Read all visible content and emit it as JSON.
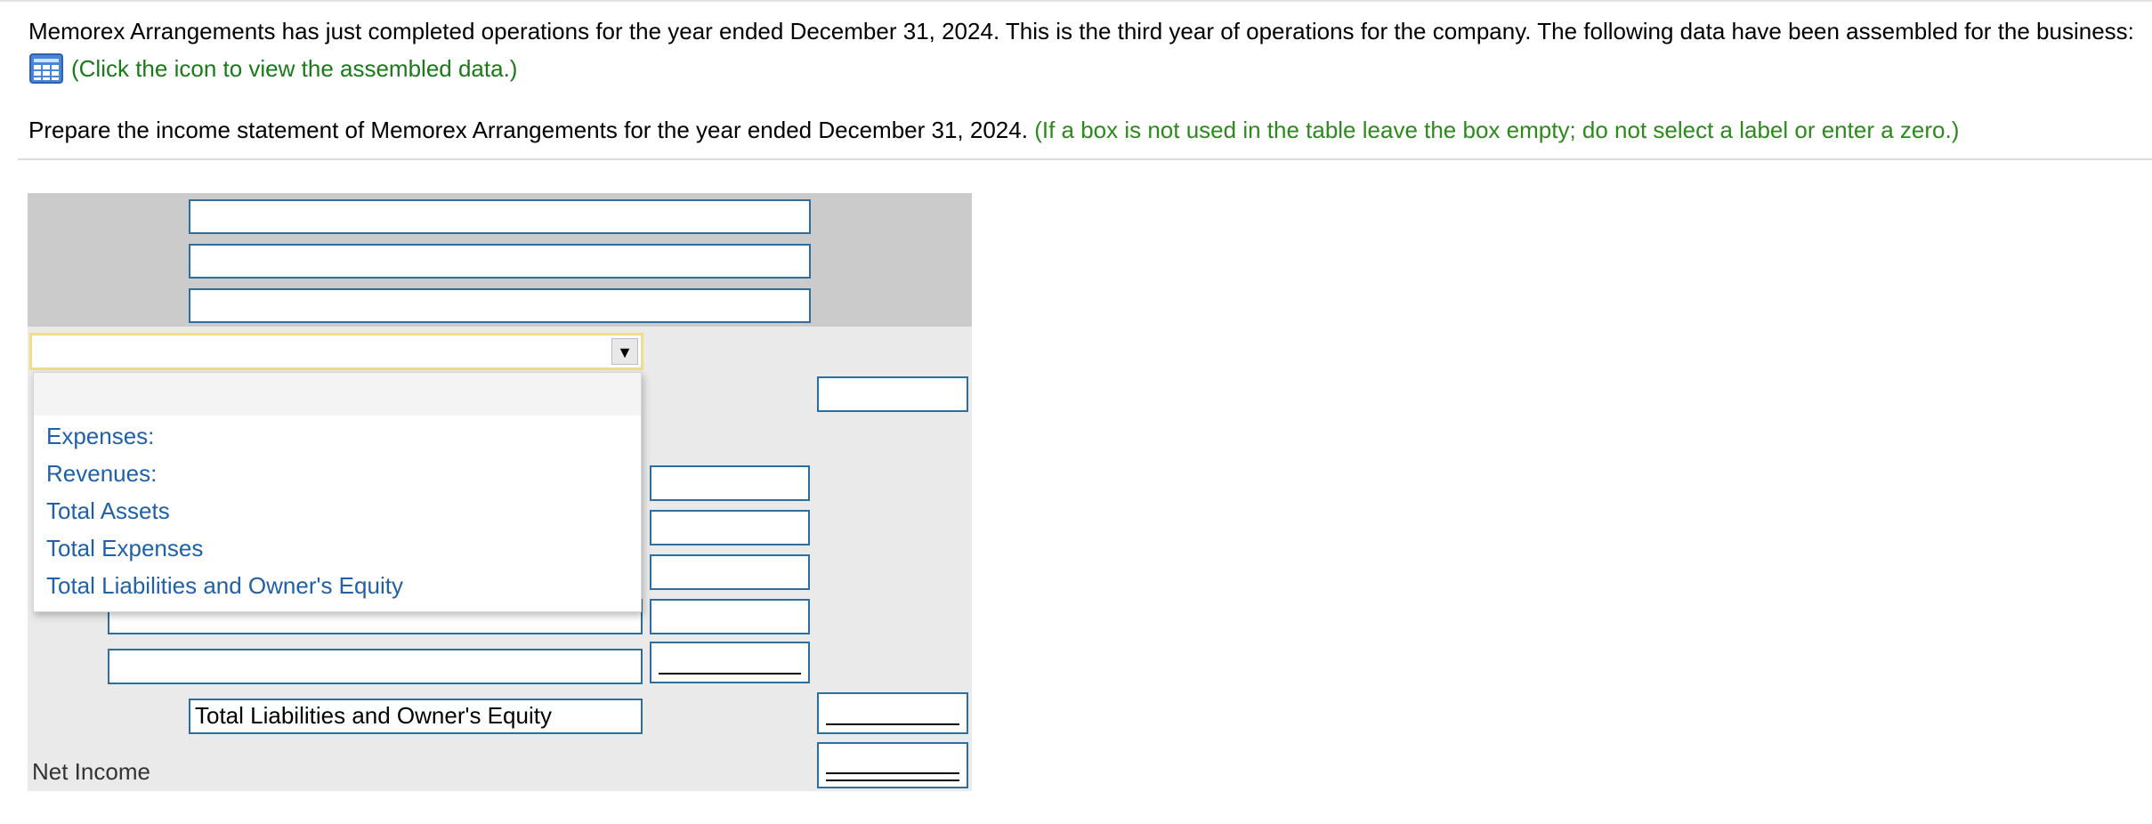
{
  "intro": {
    "paragraph": "Memorex Arrangements has just completed operations for the year ended December 31, 2024. This is the third year of operations for the company. The following data have been assembled for the business:",
    "data_link": "(Click the icon to view the assembled data.)",
    "data_icon": "table-grid-icon"
  },
  "instruction": {
    "text": "Prepare the income statement of Memorex Arrangements for the year ended December 31, 2024.",
    "note": "(If a box is not used in the table leave the box empty; do not select a label or enter a zero.)"
  },
  "form": {
    "dropdown": {
      "selected": "",
      "options": [
        "Expenses:",
        "Revenues:",
        "Total Assets",
        "Total Expenses",
        "Total Liabilities and Owner's Equity"
      ]
    },
    "total_label": "Total Liabilities and Owner's Equity",
    "net_income_label": "Net Income"
  },
  "colors": {
    "link_green": "#1a7a1a",
    "note_green": "#2a8a1a",
    "option_blue": "#2060a8",
    "input_border": "#2e6e9e",
    "focus_border": "#f2dc88"
  }
}
